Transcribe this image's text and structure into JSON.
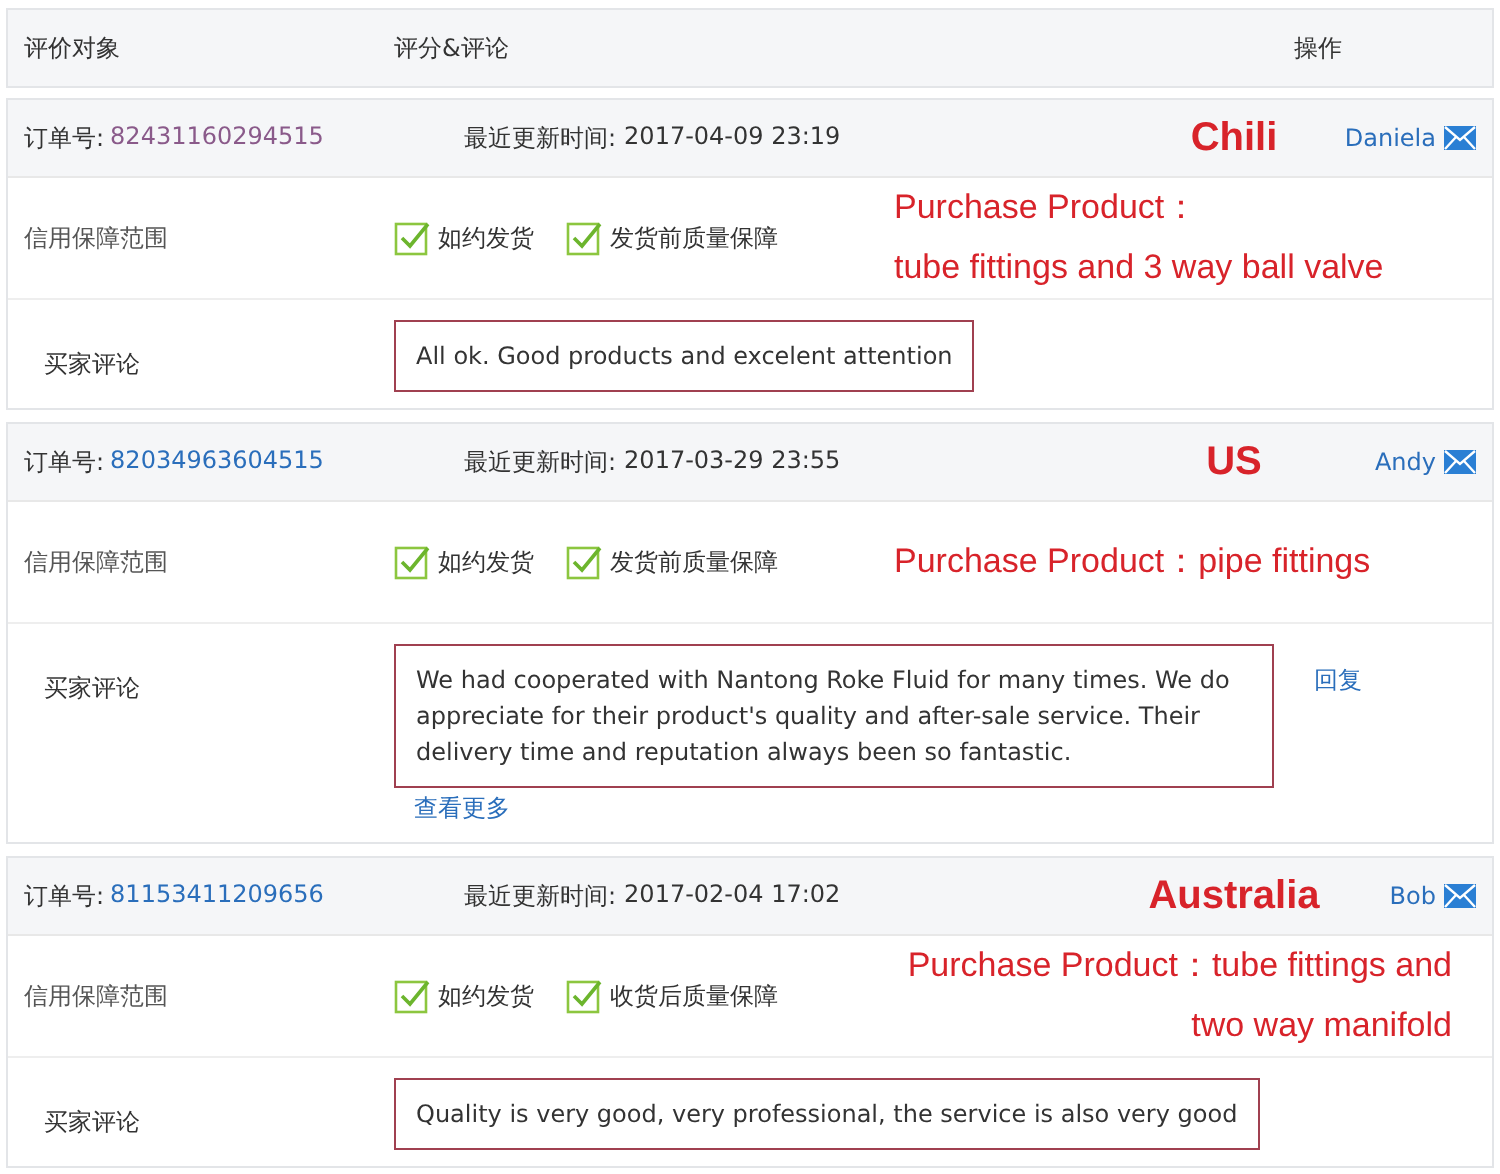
{
  "columns": [
    "评价对象",
    "评分&评论",
    "操作"
  ],
  "orders": [
    {
      "order_label": "订单号:",
      "order_no": "82431160294515",
      "visited": true,
      "time_label": "最近更新时间:",
      "time": "2017-04-09 23:19",
      "country": "Chili",
      "buyer": "Daniela",
      "guarantee_label": "信用保障范围",
      "guarantees": [
        {
          "text": "如约发货",
          "checked": true
        },
        {
          "text": "发货前质量保障",
          "checked": true
        }
      ],
      "note_lines": [
        "Purchase Product：",
        "tube fittings and  3 way ball valve"
      ],
      "kind": "plain",
      "comment_label": "买家评论",
      "comment": "All ok. Good products and excelent attention"
    },
    {
      "order_label": "订单号:",
      "order_no": "82034963604515",
      "visited": false,
      "time_label": "最近更新时间:",
      "time": "2017-03-29 23:55",
      "country": "US",
      "buyer": "Andy",
      "guarantee_label": "信用保障范围",
      "guarantees": [
        {
          "text": "如约发货",
          "checked": true
        },
        {
          "text": "发货前质量保障",
          "checked": true
        }
      ],
      "note_lines": [
        "Purchase Product：pipe fittings"
      ],
      "kind": "plain",
      "comment_label": "买家评论",
      "comment": "We had cooperated with Nantong Roke Fluid for many times. We do appreciate for their product's quality and after-sale service. Their delivery time and reputation always been so fantastic.",
      "more": "查看更多",
      "reply": "回复"
    },
    {
      "order_label": "订单号:",
      "order_no": "81153411209656",
      "visited": false,
      "time_label": "最近更新时间:",
      "time": "2017-02-04 17:02",
      "country": "Australia",
      "buyer": "Bob",
      "guarantee_label": "信用保障范围",
      "guarantees": [
        {
          "text": "如约发货",
          "checked": true
        },
        {
          "text": "收货后质量保障",
          "checked": true
        }
      ],
      "note_lines": [
        "Purchase Product：tube fittings and",
        "two way manifold"
      ],
      "kind": "hanging",
      "comment_label": "买家评论",
      "comment": "Quality is very good, very professional, the service is also very good"
    }
  ]
}
